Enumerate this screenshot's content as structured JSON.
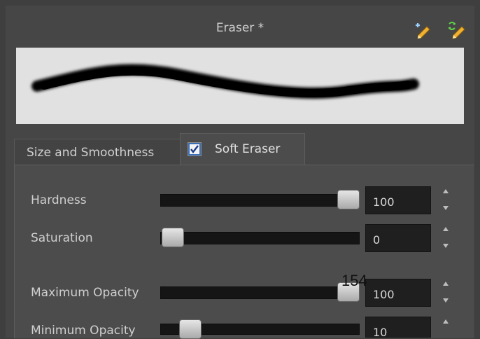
{
  "window": {
    "title": "Eraser *"
  },
  "toolbar_icons": [
    "add-preset-icon",
    "refresh-preset-icon"
  ],
  "tabs": [
    {
      "label": "Size and Smoothness",
      "active": false
    },
    {
      "label": "Soft Eraser",
      "active": true,
      "checked": true
    }
  ],
  "sliders": [
    {
      "label": "Hardness",
      "value": "100",
      "fraction": 1.0
    },
    {
      "label": "Saturation",
      "value": "0",
      "fraction": 0.0
    },
    {
      "label": "Maximum Opacity",
      "value": "100",
      "fraction": 1.0
    },
    {
      "label": "Minimum Opacity",
      "value": "10",
      "fraction": 0.1
    }
  ],
  "overlay_text": "154",
  "colors": {
    "panel": "#464646",
    "preview_bg": "#e1e1e1",
    "track": "#151515"
  }
}
